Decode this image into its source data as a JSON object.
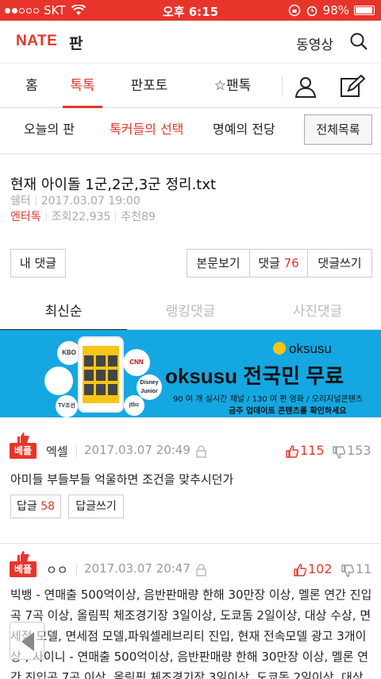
{
  "status_bar": {
    "carrier": "SKT",
    "time": "오후 6:15",
    "battery": "98%"
  },
  "header": {
    "logo": "NATE",
    "section": "판",
    "video_link": "동영상"
  },
  "main_tabs": [
    {
      "label": "홈"
    },
    {
      "label": "톡톡"
    },
    {
      "label": "판포토"
    },
    {
      "label": "☆팬톡"
    }
  ],
  "sub_tabs": [
    {
      "label": "오늘의 판"
    },
    {
      "label": "톡커들의 선택"
    },
    {
      "label": "명예의 전당"
    }
  ],
  "all_list_button": "전체목록",
  "post": {
    "title": "현재 아이돌 1군,2군,3군 정리.txt",
    "author": "쉘터",
    "date": "2017.03.07 19:00",
    "category": "엔터톡",
    "views": "조회22,935",
    "recommends": "추천89"
  },
  "actions": {
    "my_comments": "내 댓글",
    "view_body": "본문보기",
    "comment_label": "댓글",
    "comment_count": "76",
    "write_comment": "댓글쓰기"
  },
  "comment_tabs": [
    {
      "label": "최신순"
    },
    {
      "label": "랭킹댓글"
    },
    {
      "label": "사진댓글"
    }
  ],
  "banner": {
    "brand": "oksusu",
    "headline": "oksusu 전국민 무료",
    "line1": "90 여 개 실시간 채널 / 130 여 편 영화 / 오리지널콘텐츠",
    "line2": "금주 업데이트 콘텐츠를 확인하세요",
    "channels": [
      "KBO",
      "CNN",
      "Disney Junior",
      "jtbc",
      "TV조선"
    ]
  },
  "comments": [
    {
      "badge": "베플",
      "author": "엑셀",
      "date": "2017.03.07 20:49",
      "up": "115",
      "down": "153",
      "text": "아미들 부들부들 억울하면 조건을 맞추시던가",
      "reply_label": "답글",
      "reply_count": "58",
      "write_reply": "답글쓰기"
    },
    {
      "badge": "베플",
      "author": "ㅇㅇ",
      "date": "2017.03.07 20:47",
      "up": "102",
      "down": "11",
      "text": "빅뱅 - 연매출 500억이상, 음반판매량 한해 30만장 이상, 멜론 연간 진입곡 7곡 이상, 올림픽 체조경기장 3일이상, 도쿄돔 2일이상, 대상 수상, 면세점 모델, 면세점 모델,파워셀레브리티 진입, 현재 전속모델 광고 3개이상 , 사이니 - 연매출 500억이상, 음반판매량 한해 30만장 이상, 멜론 연간 진입곡 7곡 이상, 올림픽 체조경기장 3일이상, 도쿄돔 2일이상, 대상"
    }
  ],
  "colors": {
    "accent": "#e8352c",
    "banner_bg": "#14a7e2"
  }
}
